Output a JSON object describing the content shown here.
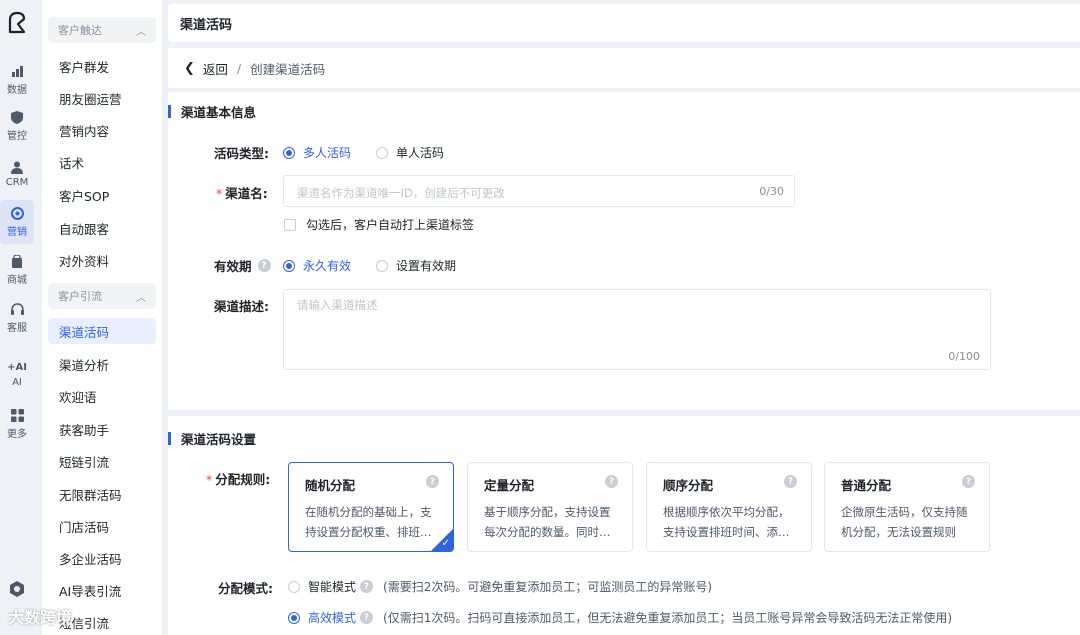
{
  "rail": {
    "items": [
      {
        "label": "数据",
        "icon": "chart-icon"
      },
      {
        "label": "管控",
        "icon": "shield-icon"
      },
      {
        "label": "CRM",
        "icon": "user-icon"
      },
      {
        "label": "营销",
        "icon": "target-icon"
      },
      {
        "label": "商城",
        "icon": "shop-icon"
      },
      {
        "label": "客服",
        "icon": "headset-icon"
      },
      {
        "label": "AI",
        "icon": "ai-icon",
        "icon_text": "+AI"
      },
      {
        "label": "更多",
        "icon": "grid-icon"
      }
    ],
    "active": "营销"
  },
  "sidebar": {
    "group1": "客户触达",
    "group1_items": [
      "客户群发",
      "朋友圈运营",
      "营销内容",
      "话术",
      "客户SOP",
      "自动跟客",
      "对外资料"
    ],
    "group2": "客户引流",
    "group2_items": [
      "渠道活码",
      "渠道分析",
      "欢迎语",
      "获客助手",
      "短链引流",
      "无限群活码",
      "门店活码",
      "多企业活码",
      "AI导表引流",
      "短信引流"
    ],
    "active": "渠道活码"
  },
  "header": {
    "title": "渠道活码"
  },
  "breadcrumb": {
    "back": "返回",
    "separator": "/",
    "current": "创建渠道活码"
  },
  "basic": {
    "section_title": "渠道基本信息",
    "type_label": "活码类型:",
    "type_options": [
      "多人活码",
      "单人活码"
    ],
    "name_label": "渠道名:",
    "name_placeholder": "渠道名作为渠道唯一ID，创建后不可更改",
    "name_count": "0/30",
    "tag_checkbox": "勾选后，客户自动打上渠道标签",
    "validity_label": "有效期",
    "validity_options": [
      "永久有效",
      "设置有效期"
    ],
    "desc_label": "渠道描述:",
    "desc_placeholder": "请输入渠道描述",
    "desc_count": "0/100"
  },
  "settings": {
    "section_title": "渠道活码设置",
    "rule_label": "分配规则:",
    "rules": [
      {
        "title": "随机分配",
        "desc": "在随机分配的基础上，支持设置分配权重、排班…"
      },
      {
        "title": "定量分配",
        "desc": "基于顺序分配，支持设置每次分配的数量。同时…"
      },
      {
        "title": "顺序分配",
        "desc": "根据顺序依次平均分配，支持设置排班时间、添…"
      },
      {
        "title": "普通分配",
        "desc": "企微原生活码，仅支持随机分配，无法设置规则"
      }
    ],
    "mode_label": "分配模式:",
    "modes": [
      {
        "name": "智能模式",
        "note": "(需要扫2次码。可避免重复添加员工；可监测员工的异常账号)"
      },
      {
        "name": "高效模式",
        "note": "(仅需扫1次码。扫码可直接添加员工，但无法避免重复添加员工；当员工账号异常会导致活码无法正常使用)"
      }
    ]
  },
  "brand_text": "大数跨境",
  "colors": {
    "accent": "#3163e0",
    "required": "#f53f3f"
  }
}
